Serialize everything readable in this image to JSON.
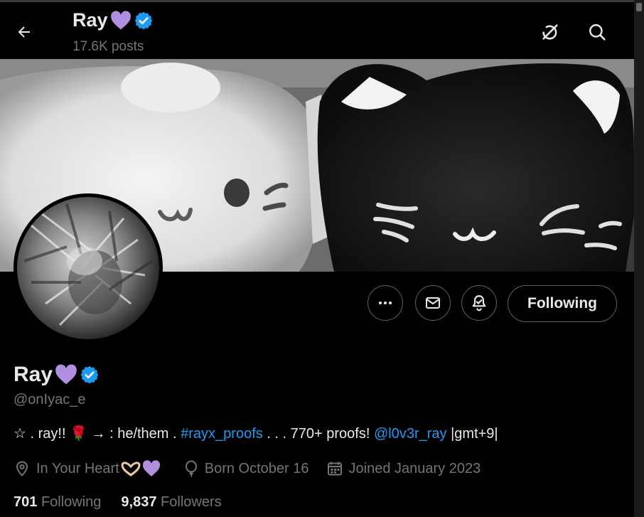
{
  "header": {
    "name": "Ray",
    "posts": "17.6K posts"
  },
  "profile": {
    "name": "Ray",
    "handle": "@onIyac_e",
    "bio": {
      "prefix": "☆ . ray!! ",
      "rose": "🌹",
      "middle": " → : he/them . ",
      "hashtag": "#rayx_proofs",
      "after_hashtag": " . . . 770+ proofs! ",
      "mention": "@l0v3r_ray",
      "suffix": " |gmt+9|"
    },
    "location": "In Your Heart",
    "birthday": "Born October 16",
    "joined": "Joined January 2023"
  },
  "stats": {
    "following_count": "701",
    "following_label": "Following",
    "followers_count": "9,837",
    "followers_label": "Followers"
  },
  "actions": {
    "following_label": "Following"
  },
  "colors": {
    "background": "#000000",
    "text": "#e7e9ea",
    "muted": "#71767b",
    "link": "#1d9bf0",
    "verified": "#1d9bf0",
    "heart": "#b08ee0",
    "border": "#536471"
  },
  "icons": [
    "back-arrow-icon",
    "grok-icon",
    "search-icon",
    "verified-badge-icon",
    "purple-heart-icon",
    "more-icon",
    "mail-icon",
    "notification-bell-icon",
    "location-icon",
    "birthday-balloon-icon",
    "calendar-icon"
  ]
}
